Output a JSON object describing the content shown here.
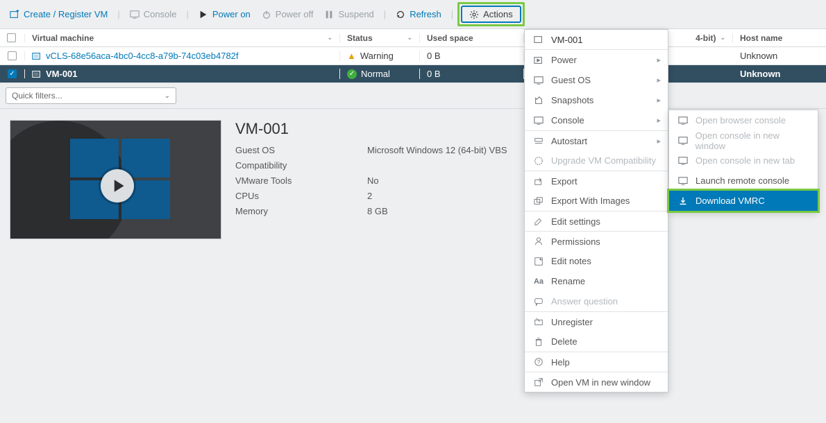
{
  "toolbar": {
    "create": "Create / Register VM",
    "console": "Console",
    "poweron": "Power on",
    "poweroff": "Power off",
    "suspend": "Suspend",
    "refresh": "Refresh",
    "actions": "Actions"
  },
  "columns": {
    "vm": "Virtual machine",
    "status": "Status",
    "used": "Used space",
    "guest_hidden": "4-bit)",
    "host": "Host name"
  },
  "rows": [
    {
      "name": "vCLS-68e56aca-4bc0-4cc8-a79b-74c03eb4782f",
      "status": "Warning",
      "used": "0 B",
      "host": "Unknown",
      "selected": false,
      "warn": true
    },
    {
      "name": "VM-001",
      "status": "Normal",
      "used": "0 B",
      "host": "Unknown",
      "selected": true,
      "warn": false
    }
  ],
  "filter_placeholder": "Quick filters...",
  "details": {
    "title": "VM-001",
    "props": [
      {
        "label": "Guest OS",
        "value": "Microsoft Windows 12 (64-bit) VBS"
      },
      {
        "label": "Compatibility",
        "value": ""
      },
      {
        "label": "VMware Tools",
        "value": "No"
      },
      {
        "label": "CPUs",
        "value": "2"
      },
      {
        "label": "Memory",
        "value": "8 GB"
      }
    ]
  },
  "menu_title": "VM-001",
  "menu1": [
    {
      "label": "Power",
      "icon": "power",
      "sub": true
    },
    {
      "label": "Guest OS",
      "icon": "guest",
      "sub": true
    },
    {
      "label": "Snapshots",
      "icon": "snapshot",
      "sub": true
    },
    {
      "label": "Console",
      "icon": "console",
      "sub": true
    },
    {
      "label": "Autostart",
      "icon": "autostart",
      "sub": true,
      "sep": true
    },
    {
      "label": "Upgrade VM Compatibility",
      "icon": "upgrade",
      "disabled": true
    },
    {
      "label": "Export",
      "icon": "export",
      "sep": true
    },
    {
      "label": "Export With Images",
      "icon": "export-img"
    },
    {
      "label": "Edit settings",
      "icon": "edit",
      "sep": true
    },
    {
      "label": "Permissions",
      "icon": "perm",
      "sep": true
    },
    {
      "label": "Edit notes",
      "icon": "notes"
    },
    {
      "label": "Rename",
      "icon": "rename"
    },
    {
      "label": "Answer question",
      "icon": "answer",
      "disabled": true
    },
    {
      "label": "Unregister",
      "icon": "unregister",
      "sep": true
    },
    {
      "label": "Delete",
      "icon": "delete"
    },
    {
      "label": "Help",
      "icon": "help",
      "sep": true
    },
    {
      "label": "Open VM in new window",
      "icon": "open",
      "sep": true
    }
  ],
  "menu2": [
    {
      "label": "Open browser console",
      "disabled": true
    },
    {
      "label": "Open console in new window",
      "disabled": true
    },
    {
      "label": "Open console in new tab",
      "disabled": true
    },
    {
      "label": "Launch remote console",
      "disabled": false
    },
    {
      "label": "Download VMRC",
      "highlighted": true
    }
  ]
}
